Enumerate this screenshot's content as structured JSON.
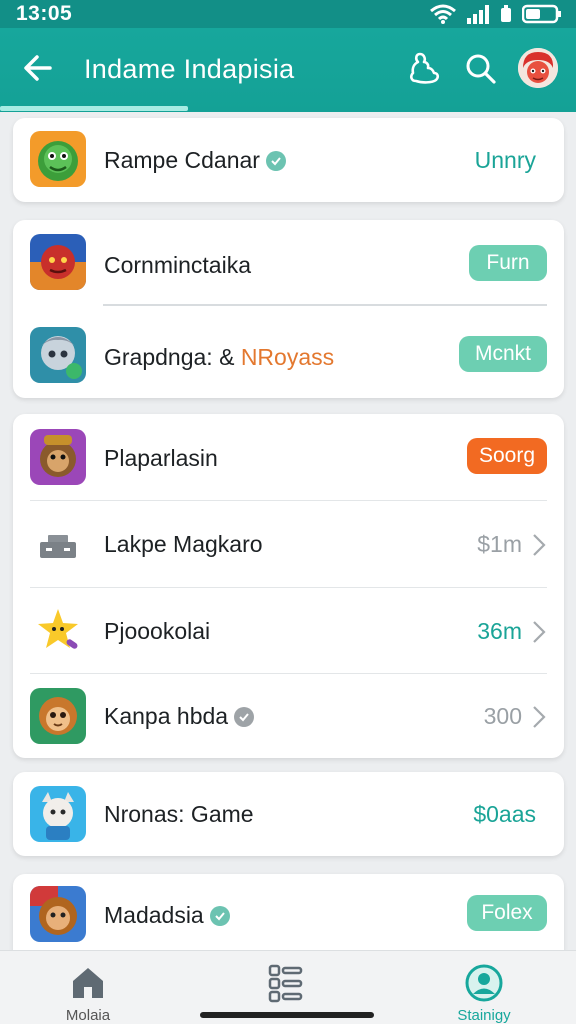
{
  "status": {
    "time": "13:05"
  },
  "appbar": {
    "title": "Indame Indapisia"
  },
  "apps": [
    {
      "name": "Rampe Cdanar",
      "verified": true,
      "action": "Unnry",
      "action_style": "text-teal"
    },
    {
      "name": "Cornminctaika",
      "verified": false,
      "action": "Furn",
      "action_style": "pill-teal"
    },
    {
      "name": "Grapdnga: & ",
      "name_accent": "NRoyass",
      "verified": false,
      "action": "Mcnkt",
      "action_style": "pill-teal"
    },
    {
      "name": "Plaparlasin",
      "verified": false,
      "action": "Soorg",
      "action_style": "pill-orange"
    },
    {
      "name": "Lakpe Magkaro",
      "verified": false,
      "action": "$1m",
      "action_style": "text-gray-chevron"
    },
    {
      "name": "Pjoookolai",
      "verified": false,
      "action": "36m",
      "action_style": "text-teal-chevron"
    },
    {
      "name": "Kanpa hbda",
      "verified": true,
      "action": "300",
      "action_style": "text-gray-chevron"
    },
    {
      "name": "Nronas: Game",
      "verified": false,
      "action": "$0aas",
      "action_style": "text-teal"
    },
    {
      "name": "Madadsia",
      "verified": true,
      "action": "Folex",
      "action_style": "pill-teal"
    }
  ],
  "bottom_nav": [
    {
      "label": "Molaia",
      "icon": "home-icon"
    },
    {
      "label": "",
      "icon": "list-icon"
    },
    {
      "label": "Stainigy",
      "icon": "profile-icon"
    }
  ],
  "colors": {
    "teal": "#17a79c",
    "pill_teal": "#6dcfb2",
    "orange": "#f26a22"
  }
}
